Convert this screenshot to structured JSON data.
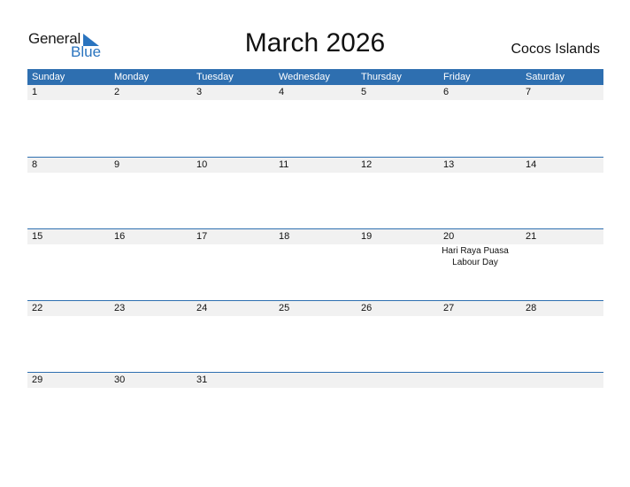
{
  "logo": {
    "word1": "General",
    "word2": "Blue",
    "brand_color": "#2a74bf"
  },
  "title": "March 2026",
  "country": "Cocos Islands",
  "colors": {
    "header_bg": "#2e6fb0",
    "date_strip_bg": "#f1f1f1"
  },
  "weekdays": [
    "Sunday",
    "Monday",
    "Tuesday",
    "Wednesday",
    "Thursday",
    "Friday",
    "Saturday"
  ],
  "weeks": [
    {
      "days": [
        "1",
        "2",
        "3",
        "4",
        "5",
        "6",
        "7"
      ],
      "events": [
        [],
        [],
        [],
        [],
        [],
        [],
        []
      ]
    },
    {
      "days": [
        "8",
        "9",
        "10",
        "11",
        "12",
        "13",
        "14"
      ],
      "events": [
        [],
        [],
        [],
        [],
        [],
        [],
        []
      ]
    },
    {
      "days": [
        "15",
        "16",
        "17",
        "18",
        "19",
        "20",
        "21"
      ],
      "events": [
        [],
        [],
        [],
        [],
        [],
        [
          "Hari Raya Puasa",
          "Labour Day"
        ],
        []
      ]
    },
    {
      "days": [
        "22",
        "23",
        "24",
        "25",
        "26",
        "27",
        "28"
      ],
      "events": [
        [],
        [],
        [],
        [],
        [],
        [],
        []
      ]
    },
    {
      "days": [
        "29",
        "30",
        "31",
        "",
        "",
        "",
        ""
      ],
      "events": [
        [],
        [],
        [],
        [],
        [],
        [],
        []
      ]
    }
  ]
}
